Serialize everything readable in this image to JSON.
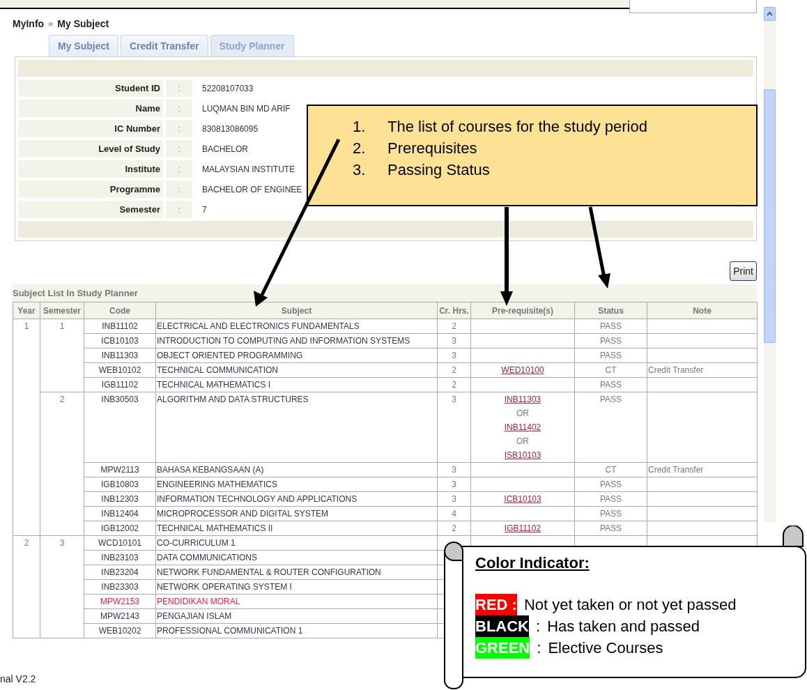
{
  "breadcrumb": {
    "items": [
      "MyInfo",
      "My Subject"
    ],
    "separator": "»"
  },
  "tabs": [
    {
      "label": "My Subject",
      "selected": false
    },
    {
      "label": "Credit Transfer",
      "selected": false
    },
    {
      "label": "Study Planner",
      "selected": true
    }
  ],
  "student_info": [
    {
      "label": "Student ID",
      "separator": ":",
      "value": "52208107033"
    },
    {
      "label": "Name",
      "separator": ":",
      "value": "LUQMAN BIN MD ARIF"
    },
    {
      "label": "IC Number",
      "separator": ":",
      "value": "830813086095"
    },
    {
      "label": "Level of Study",
      "separator": ":",
      "value": "BACHELOR"
    },
    {
      "label": "Institute",
      "separator": ":",
      "value": "MALAYSIAN INSTITUTE"
    },
    {
      "label": "Programme",
      "separator": ":",
      "value": "BACHELOR OF ENGINEE"
    },
    {
      "label": "Semester",
      "separator": ":",
      "value": "7"
    }
  ],
  "print_button": "Print",
  "subject_list": {
    "title": "Subject List In Study Planner",
    "columns": [
      "Year",
      "Semester",
      "Code",
      "Subject",
      "Cr. Hrs.",
      "Pre-requisite(s)",
      "Status",
      "Note"
    ],
    "years": [
      {
        "year": "1",
        "semesters": [
          {
            "semester": "1",
            "subjects": [
              {
                "code": "INB11102",
                "subject": "ELECTRICAL AND ELECTRONICS FUNDAMENTALS",
                "credit_hours": "2",
                "status": "PASS",
                "passed": true
              },
              {
                "code": "ICB10103",
                "subject": "INTRODUCTION TO COMPUTING AND INFORMATION SYSTEMS",
                "credit_hours": "3",
                "status": "PASS",
                "passed": true
              },
              {
                "code": "INB11303",
                "subject": "OBJECT ORIENTED PROGRAMMING",
                "credit_hours": "3",
                "status": "PASS",
                "passed": true
              },
              {
                "code": "WEB10102",
                "subject": "TECHNICAL COMMUNICATION",
                "credit_hours": "2",
                "prerequisites": [
                  {
                    "kind": "link",
                    "text": "WED10100"
                  }
                ],
                "status": "CT",
                "note": "Credit Transfer",
                "passed": true
              },
              {
                "code": "IGB11102",
                "subject": "TECHNICAL MATHEMATICS I",
                "credit_hours": "2",
                "status": "PASS",
                "passed": true
              }
            ]
          },
          {
            "semester": "2",
            "subjects": [
              {
                "code": "INB30503",
                "subject": "ALGORITHM AND DATA STRUCTURES",
                "credit_hours": "3",
                "prerequisites": [
                  {
                    "kind": "link",
                    "text": "INB11303"
                  },
                  {
                    "kind": "separator",
                    "text": "OR"
                  },
                  {
                    "kind": "link",
                    "text": "INB11402"
                  },
                  {
                    "kind": "separator",
                    "text": "OR"
                  },
                  {
                    "kind": "link",
                    "text": "ISB10103"
                  }
                ],
                "status": "PASS",
                "passed": true
              },
              {
                "code": "MPW2113",
                "subject": "BAHASA KEBANGSAAN (A)",
                "credit_hours": "3",
                "status": "CT",
                "note": "Credit Transfer",
                "passed": true
              },
              {
                "code": "IGB10803",
                "subject": "ENGINEERING MATHEMATICS",
                "credit_hours": "3",
                "status": "PASS",
                "passed": true
              },
              {
                "code": "INB12303",
                "subject": "INFORMATION TECHNOLOGY AND APPLICATIONS",
                "credit_hours": "3",
                "prerequisites": [
                  {
                    "kind": "link",
                    "text": "ICB10103"
                  }
                ],
                "status": "PASS",
                "passed": true
              },
              {
                "code": "INB12404",
                "subject": "MICROPROCESSOR AND DIGITAL SYSTEM",
                "credit_hours": "4",
                "status": "PASS",
                "passed": true
              },
              {
                "code": "IGB12002",
                "subject": "TECHNICAL MATHEMATICS II",
                "credit_hours": "2",
                "prerequisites": [
                  {
                    "kind": "link",
                    "text": "IGB11102"
                  }
                ],
                "status": "PASS",
                "passed": true
              }
            ]
          }
        ]
      },
      {
        "year": "2",
        "semesters": [
          {
            "semester": "3",
            "subjects": [
              {
                "code": "WCD10101",
                "subject": "CO-CURRICULUM 1",
                "passed": true
              },
              {
                "code": "INB23103",
                "subject": "DATA COMMUNICATIONS",
                "passed": true
              },
              {
                "code": "INB23204",
                "subject": "NETWORK FUNDAMENTAL & ROUTER CONFIGURATION",
                "passed": true
              },
              {
                "code": "INB23303",
                "subject": "NETWORK OPERATING SYSTEM I",
                "passed": true
              },
              {
                "code": "MPW2153",
                "subject": "PENDIDIKAN MORAL",
                "passed": false
              },
              {
                "code": "MPW2143",
                "subject": "PENGAJIAN ISLAM",
                "passed": true
              },
              {
                "code": "WEB10202",
                "subject": "PROFESSIONAL COMMUNICATION 1",
                "passed": true
              }
            ]
          }
        ]
      }
    ]
  },
  "callout": {
    "items": [
      {
        "number": "1.",
        "text": "The list of courses for the study period"
      },
      {
        "number": "2.",
        "text": "Prerequisites"
      },
      {
        "number": "3.",
        "text": "Passing Status"
      }
    ]
  },
  "legend": {
    "title": "Color Indicator:",
    "items": [
      {
        "label": "RED :",
        "color": "#ff0000",
        "text": "Not yet taken or not yet passed"
      },
      {
        "label": "BLACK",
        "color": "#000000",
        "separator": ":",
        "text": "Has taken and passed"
      },
      {
        "label": "GREEN",
        "color": "#00ff00",
        "separator": ":",
        "text": "Elective Courses"
      }
    ]
  },
  "footer": "nal V2.2"
}
